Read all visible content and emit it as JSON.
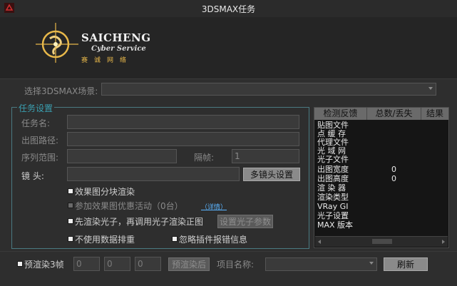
{
  "window": {
    "title": "3DSMAX任务"
  },
  "brand": {
    "name": "SAICHENG",
    "sub": "Cyber Service",
    "cn": "赛诚网络"
  },
  "scene": {
    "label": "选择3DSMAX场景:",
    "value": ""
  },
  "task_group": {
    "title": "任务设置",
    "task_name_label": "任务名:",
    "output_path_label": "出图路径:",
    "sequence_label": "序列范围:",
    "interval_label": "隔帧:",
    "interval_value": "1",
    "camera_label": "镜    头:",
    "multi_camera_button": "多镜头设置",
    "split_render_label": "效果图分块渲染",
    "join_promo_label": "参加效果图优惠活动（0台）",
    "detail_link": "（详情）",
    "photon_first_label": "先渲染光子，再调用光子渲染正图",
    "photon_params_button": "设置光子参数",
    "no_queue_label": "不使用数据排重",
    "ignore_plugin_label": "忽略插件报错信息"
  },
  "panel": {
    "columns": [
      "检测反馈",
      "总数/丢失",
      "结果"
    ],
    "rows": [
      {
        "label": "贴图文件",
        "value": ""
      },
      {
        "label": "点 缓 存",
        "value": ""
      },
      {
        "label": "代理文件",
        "value": ""
      },
      {
        "label": "光 域 网",
        "value": ""
      },
      {
        "label": "光子文件",
        "value": ""
      },
      {
        "label": "出图宽度",
        "value": "0"
      },
      {
        "label": "出图高度",
        "value": "0"
      },
      {
        "label": "渲 染 器",
        "value": ""
      },
      {
        "label": "渲染类型",
        "value": ""
      },
      {
        "label": "VRay GI",
        "value": ""
      },
      {
        "label": "光子设置",
        "value": ""
      },
      {
        "label": "MAX 版本",
        "value": ""
      }
    ]
  },
  "bottom": {
    "prerender_label": "预渲染3帧",
    "field1": "0",
    "field2": "0",
    "field3": "0",
    "after_prerender_button": "预渲染后",
    "project_label": "项目名称:",
    "project_value": "",
    "refresh_button": "刷新"
  },
  "colors": {
    "accent": "#3a9fb0",
    "gold": "#e8b84a",
    "link": "#5ab4ff"
  }
}
